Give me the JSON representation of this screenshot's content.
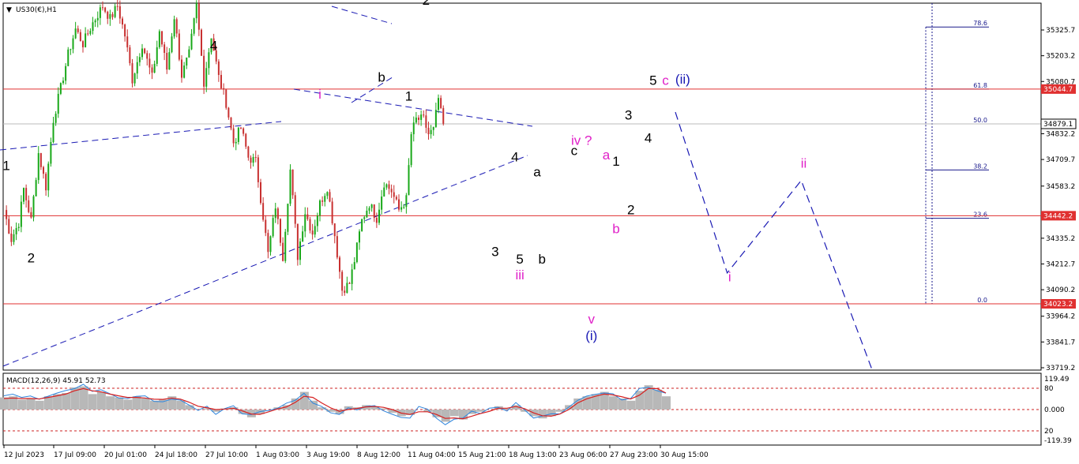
{
  "header": {
    "title": "US30(€),H1",
    "macd_label": "MACD(12,26,9) 45.91 52.73"
  },
  "colors": {
    "bull": "#18a818",
    "bear": "#c83030",
    "level": "#e03030",
    "wave_blue": "#1a1ab4",
    "wave_pink": "#e020c8",
    "fib": "#1a1a8c"
  },
  "chart_data": {
    "type": "candlestick",
    "title": "US30(€),H1",
    "price_axis_ticks": [
      35325.7,
      35203.2,
      35080.7,
      34832.2,
      34709.7,
      34583.2,
      34335.2,
      34212.7,
      34090.2,
      33964.2,
      33841.7,
      33719.2
    ],
    "time_axis_ticks": [
      "12 Jul 2023",
      "17 Jul 09:00",
      "20 Jul 01:00",
      "24 Jul 18:00",
      "27 Jul 10:00",
      "1 Aug 03:00",
      "3 Aug 19:00",
      "8 Aug 12:00",
      "11 Aug 04:00",
      "15 Aug 21:00",
      "18 Aug 13:00",
      "23 Aug 06:00",
      "27 Aug 23:00",
      "30 Aug 15:00"
    ],
    "ylim": [
      33690,
      35440
    ],
    "current_price": 34879.1,
    "horizontal_levels": [
      {
        "label": "35044.7",
        "value": 35044.7
      },
      {
        "label": "34442.2",
        "value": 34442.2
      },
      {
        "label": "34023.2",
        "value": 34023.2
      }
    ],
    "fibonacci": [
      {
        "label": "78.6",
        "value": 35340
      },
      {
        "label": "61.8",
        "value": 35044.7
      },
      {
        "label": "50.0",
        "value": 34879.1
      },
      {
        "label": "38.2",
        "value": 34660
      },
      {
        "label": "23.6",
        "value": 34430
      },
      {
        "label": "0.0",
        "value": 34023.2
      }
    ],
    "price_path": [
      [
        0,
        34470
      ],
      [
        1.5,
        34330
      ],
      [
        3,
        34410
      ],
      [
        4,
        34570
      ],
      [
        5.5,
        34420
      ],
      [
        7,
        34740
      ],
      [
        8.5,
        34580
      ],
      [
        10,
        34900
      ],
      [
        11.5,
        35050
      ],
      [
        13,
        35210
      ],
      [
        14.5,
        35330
      ],
      [
        16,
        35260
      ],
      [
        18,
        35360
      ],
      [
        20,
        35440
      ],
      [
        21.5,
        35380
      ],
      [
        23,
        35440
      ],
      [
        24.5,
        35300
      ],
      [
        26,
        35090
      ],
      [
        28,
        35260
      ],
      [
        30,
        35100
      ],
      [
        31.5,
        35320
      ],
      [
        33,
        35140
      ],
      [
        34.5,
        35390
      ],
      [
        36,
        35110
      ],
      [
        37.5,
        35210
      ],
      [
        39,
        35440
      ],
      [
        40.5,
        35080
      ],
      [
        42,
        35300
      ],
      [
        43.5,
        35100
      ],
      [
        45,
        34980
      ],
      [
        46.5,
        34790
      ],
      [
        48,
        34860
      ],
      [
        49.5,
        34720
      ],
      [
        51,
        34700
      ],
      [
        52.5,
        34440
      ],
      [
        53.5,
        34260
      ],
      [
        55,
        34490
      ],
      [
        56.5,
        34250
      ],
      [
        58,
        34660
      ],
      [
        59.5,
        34250
      ],
      [
        61,
        34460
      ],
      [
        62.5,
        34360
      ],
      [
        64,
        34500
      ],
      [
        65.5,
        34580
      ],
      [
        67,
        34350
      ],
      [
        68.5,
        34090
      ],
      [
        70,
        34120
      ],
      [
        71,
        34230
      ],
      [
        72.5,
        34420
      ],
      [
        74,
        34500
      ],
      [
        75.5,
        34430
      ],
      [
        77,
        34600
      ],
      [
        78.5,
        34560
      ],
      [
        80,
        34470
      ],
      [
        81.5,
        34520
      ],
      [
        82.5,
        34830
      ],
      [
        83.5,
        34900
      ],
      [
        85,
        34900
      ],
      [
        86,
        34830
      ],
      [
        87,
        34850
      ],
      [
        88,
        35000
      ],
      [
        88.5,
        34930
      ],
      [
        89,
        34880
      ]
    ],
    "macd": {
      "levels": [
        "119.49",
        "80",
        "0.000",
        "20",
        "-119.39"
      ],
      "main": [
        55,
        60,
        45,
        52,
        40,
        60,
        70,
        75,
        100,
        105,
        70,
        80,
        60,
        55,
        45,
        60,
        50,
        40,
        45,
        60,
        40,
        20,
        0,
        5,
        -10,
        5,
        10,
        -20,
        -35,
        -20,
        0,
        10,
        20,
        50,
        80,
        40,
        10,
        -10,
        -20,
        15,
        10,
        20,
        15,
        5,
        -15,
        -30,
        -25,
        0,
        -10,
        -35,
        -55,
        -30,
        -45,
        -20,
        -10,
        0,
        15,
        5,
        20,
        -10,
        -30,
        -40,
        -30,
        -10,
        20,
        50,
        60,
        70,
        80,
        60,
        50,
        40,
        85,
        110,
        90,
        60
      ],
      "signal": [
        50,
        52,
        50,
        50,
        48,
        55,
        62,
        70,
        85,
        95,
        85,
        80,
        70,
        62,
        55,
        55,
        52,
        47,
        46,
        52,
        47,
        33,
        15,
        8,
        0,
        2,
        6,
        -6,
        -20,
        -22,
        -10,
        3,
        12,
        32,
        60,
        55,
        30,
        8,
        -8,
        0,
        5,
        12,
        14,
        10,
        0,
        -16,
        -22,
        -10,
        -10,
        -22,
        -40,
        -38,
        -42,
        -30,
        -18,
        -8,
        6,
        6,
        14,
        4,
        -15,
        -28,
        -30,
        -20,
        0,
        30,
        48,
        60,
        70,
        66,
        58,
        48,
        65,
        95,
        95,
        75
      ]
    },
    "wave_labels": [
      {
        "text": "1",
        "x": 0.5,
        "y": 34660,
        "color": "black"
      },
      {
        "text": "2",
        "x": 5.5,
        "y": 34220,
        "color": "black"
      },
      {
        "text": "4",
        "x": 42.5,
        "y": 35230,
        "color": "black"
      },
      {
        "text": "i",
        "x": 64,
        "y": 35000,
        "color": "pink"
      },
      {
        "text": "b",
        "x": 76.5,
        "y": 35080,
        "color": "black"
      },
      {
        "text": "2",
        "x": 85.5,
        "y": 35445,
        "color": "black"
      },
      {
        "text": "1",
        "x": 82,
        "y": 34990,
        "color": "black"
      },
      {
        "text": "4",
        "x": 103.5,
        "y": 34700,
        "color": "black"
      },
      {
        "text": "a",
        "x": 108,
        "y": 34630,
        "color": "black"
      },
      {
        "text": "3",
        "x": 99.5,
        "y": 34250,
        "color": "black"
      },
      {
        "text": "5",
        "x": 104.5,
        "y": 34215,
        "color": "black"
      },
      {
        "text": "iii",
        "x": 104.5,
        "y": 34140,
        "color": "pink"
      },
      {
        "text": "b",
        "x": 109,
        "y": 34215,
        "color": "black"
      },
      {
        "text": "c",
        "x": 115.5,
        "y": 34730,
        "color": "black"
      },
      {
        "text": "iv ?",
        "x": 117,
        "y": 34780,
        "color": "pink"
      },
      {
        "text": "v",
        "x": 119,
        "y": 33930,
        "color": "pink"
      },
      {
        "text": "(i)",
        "x": 119,
        "y": 33850,
        "color": "blue"
      },
      {
        "text": "a",
        "x": 122,
        "y": 34710,
        "color": "pink"
      },
      {
        "text": "1",
        "x": 124,
        "y": 34680,
        "color": "black"
      },
      {
        "text": "b",
        "x": 124,
        "y": 34360,
        "color": "pink"
      },
      {
        "text": "2",
        "x": 127,
        "y": 34450,
        "color": "black"
      },
      {
        "text": "3",
        "x": 126.5,
        "y": 34900,
        "color": "black"
      },
      {
        "text": "4",
        "x": 130.5,
        "y": 34790,
        "color": "black"
      },
      {
        "text": "5",
        "x": 131.5,
        "y": 35065,
        "color": "black"
      },
      {
        "text": "c",
        "x": 134,
        "y": 35065,
        "color": "pink"
      },
      {
        "text": "(ii)",
        "x": 137.5,
        "y": 35070,
        "color": "blue"
      },
      {
        "text": "i",
        "x": 147,
        "y": 34130,
        "color": "pink"
      },
      {
        "text": "ii",
        "x": 162,
        "y": 34670,
        "color": "pink"
      }
    ],
    "projection": [
      [
        136,
        34935
      ],
      [
        146.5,
        34170
      ],
      [
        161.5,
        34610
      ],
      [
        176,
        33700
      ]
    ]
  }
}
